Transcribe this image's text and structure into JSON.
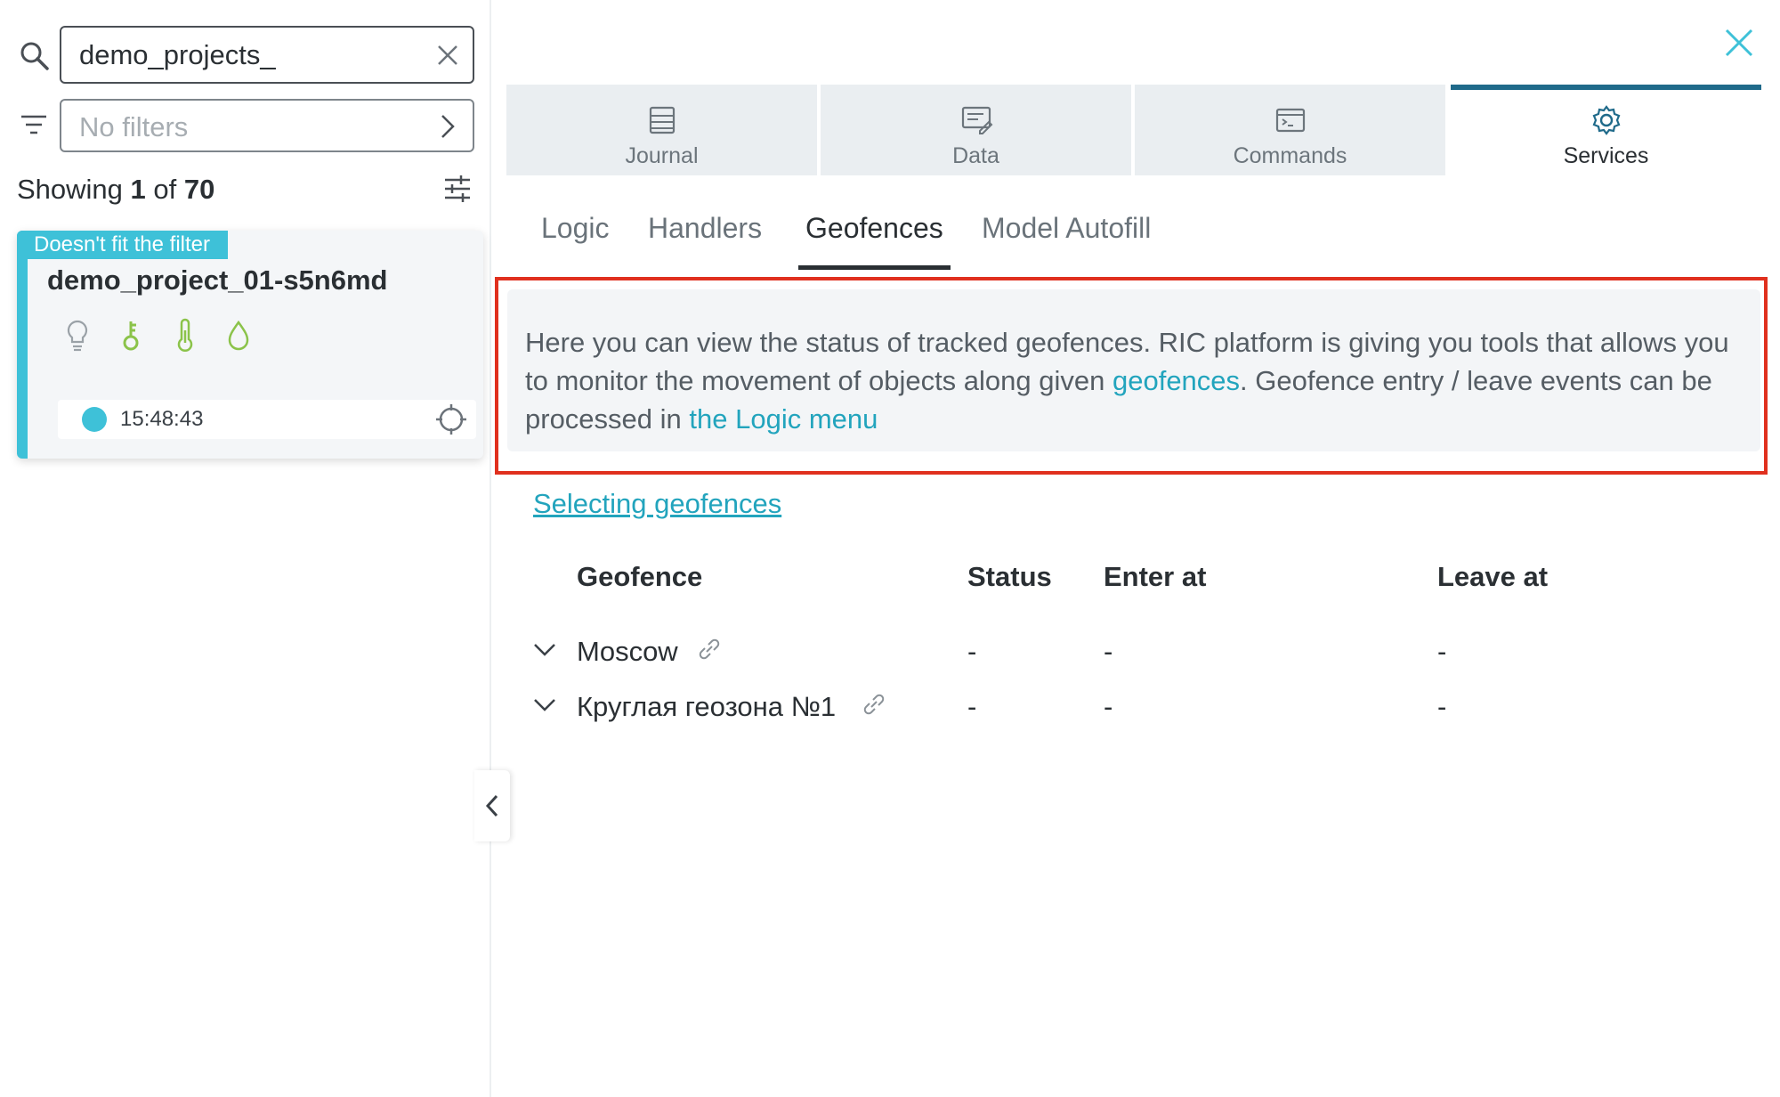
{
  "search": {
    "value": "demo_projects_"
  },
  "filters": {
    "placeholder": "No filters"
  },
  "showing": {
    "prefix": "Showing",
    "current": "1",
    "of": "of",
    "total": "70"
  },
  "card": {
    "badge": "Doesn't fit the filter",
    "name": "demo_project_01-s5n6md",
    "time": "15:48:43",
    "icons": [
      "lightbulb-icon",
      "key-icon",
      "thermometer-icon",
      "drop-icon"
    ],
    "accent": "#3ec1d8"
  },
  "top_tabs": [
    {
      "label": "Journal",
      "icon": "journal-icon",
      "active": false
    },
    {
      "label": "Data",
      "icon": "data-icon",
      "active": false
    },
    {
      "label": "Commands",
      "icon": "terminal-icon",
      "active": false
    },
    {
      "label": "Services",
      "icon": "gear-icon",
      "active": true
    }
  ],
  "sub_tabs": [
    {
      "label": "Logic",
      "active": false
    },
    {
      "label": "Handlers",
      "active": false
    },
    {
      "label": "Geofences",
      "active": true
    },
    {
      "label": "Model Autofill",
      "active": false
    }
  ],
  "info": {
    "text1": "Here you can view the status of tracked geofences. RIC platform is giving you tools that allows you to monitor the movement of objects along given ",
    "link1": "geofences",
    "text2": ". Geofence entry / leave events can be processed in ",
    "link2": "the Logic menu"
  },
  "selecting_link": "Selecting geofences",
  "table": {
    "headers": {
      "geofence": "Geofence",
      "status": "Status",
      "enter": "Enter at",
      "leave": "Leave at"
    },
    "rows": [
      {
        "name": "Moscow",
        "status": "-",
        "enter": "-",
        "leave": "-"
      },
      {
        "name": "Круглая геозона №1",
        "status": "-",
        "enter": "-",
        "leave": "-"
      }
    ]
  },
  "colors": {
    "link": "#22a4bd",
    "accent": "#3ec1d8",
    "active_tab": "#1f6a8a",
    "highlight": "#e0301e"
  }
}
